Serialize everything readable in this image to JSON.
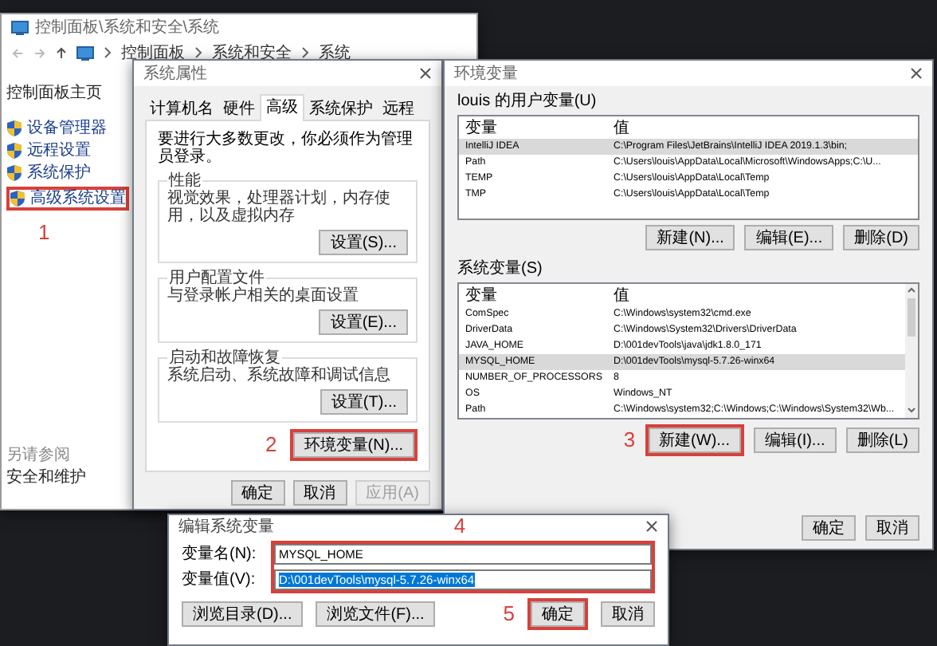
{
  "control_panel": {
    "title": "控制面板\\系统和安全\\系统",
    "breadcrumb": [
      "控制面板",
      "系统和安全",
      "系统"
    ],
    "sidebar": {
      "home": "控制面板主页",
      "items": [
        {
          "label": "设备管理器"
        },
        {
          "label": "远程设置"
        },
        {
          "label": "系统保护"
        },
        {
          "label": "高级系统设置",
          "step": "1"
        }
      ],
      "see_also": "另请参阅",
      "links": [
        "安全和维护"
      ]
    }
  },
  "system_properties": {
    "title": "系统属性",
    "tabs": [
      {
        "label": "计算机名",
        "selected": false
      },
      {
        "label": "硬件",
        "selected": false
      },
      {
        "label": "高级",
        "selected": true
      },
      {
        "label": "系统保护",
        "selected": false
      },
      {
        "label": "远程",
        "selected": false
      }
    ],
    "notice": "要进行大多数更改，你必须作为管理员登录。",
    "groups": [
      {
        "legend": "性能",
        "description": "视觉效果，处理器计划，内存使用，以及虚拟内存",
        "button": "设置(S)..."
      },
      {
        "legend": "用户配置文件",
        "description": "与登录帐户相关的桌面设置",
        "button": "设置(E)..."
      },
      {
        "legend": "启动和故障恢复",
        "description": "系统启动、系统故障和调试信息",
        "button": "设置(T)..."
      }
    ],
    "env_button": {
      "label": "环境变量(N)...",
      "step": "2"
    },
    "buttons": [
      {
        "label": "确定",
        "disabled": false
      },
      {
        "label": "取消",
        "disabled": false
      },
      {
        "label": "应用(A)",
        "disabled": true
      }
    ]
  },
  "environment_variables": {
    "title": "环境变量",
    "user_section": {
      "label": "louis 的用户变量(U)",
      "columns": [
        "变量",
        "值"
      ],
      "rows": [
        {
          "name": "IntelliJ IDEA",
          "value": "C:\\Program Files\\JetBrains\\IntelliJ IDEA 2019.1.3\\bin;",
          "selected": true
        },
        {
          "name": "Path",
          "value": "C:\\Users\\louis\\AppData\\Local\\Microsoft\\WindowsApps;C:\\U...",
          "selected": false
        },
        {
          "name": "TEMP",
          "value": "C:\\Users\\louis\\AppData\\Local\\Temp",
          "selected": false
        },
        {
          "name": "TMP",
          "value": "C:\\Users\\louis\\AppData\\Local\\Temp",
          "selected": false
        }
      ],
      "buttons": [
        {
          "label": "新建(N)..."
        },
        {
          "label": "编辑(E)..."
        },
        {
          "label": "删除(D)"
        }
      ]
    },
    "system_section": {
      "label": "系统变量(S)",
      "columns": [
        "变量",
        "值"
      ],
      "rows": [
        {
          "name": "ComSpec",
          "value": "C:\\Windows\\system32\\cmd.exe",
          "selected": false
        },
        {
          "name": "DriverData",
          "value": "C:\\Windows\\System32\\Drivers\\DriverData",
          "selected": false
        },
        {
          "name": "JAVA_HOME",
          "value": "D:\\001devTools\\java\\jdk1.8.0_171",
          "selected": false
        },
        {
          "name": "MYSQL_HOME",
          "value": "D:\\001devTools\\mysql-5.7.26-winx64",
          "selected": true
        },
        {
          "name": "NUMBER_OF_PROCESSORS",
          "value": "8",
          "selected": false
        },
        {
          "name": "OS",
          "value": "Windows_NT",
          "selected": false
        },
        {
          "name": "Path",
          "value": "C:\\Windows\\system32;C:\\Windows;C:\\Windows\\System32\\Wb...",
          "selected": false
        }
      ],
      "buttons": [
        {
          "label": "新建(W)...",
          "step": "3"
        },
        {
          "label": "编辑(I)..."
        },
        {
          "label": "删除(L)"
        }
      ]
    },
    "buttons": [
      "确定",
      "取消"
    ]
  },
  "edit_variable": {
    "title": "编辑系统变量",
    "step": "4",
    "fields": [
      {
        "label": "变量名(N):",
        "value": "MYSQL_HOME",
        "value_selected": false
      },
      {
        "label": "变量值(V):",
        "value": "D:\\001devTools\\mysql-5.7.26-winx64",
        "value_selected": true
      }
    ],
    "buttons_left": [
      {
        "label": "浏览目录(D)..."
      },
      {
        "label": "浏览文件(F)..."
      }
    ],
    "buttons_right": [
      {
        "label": "确定",
        "step": "5"
      },
      {
        "label": "取消"
      }
    ]
  }
}
